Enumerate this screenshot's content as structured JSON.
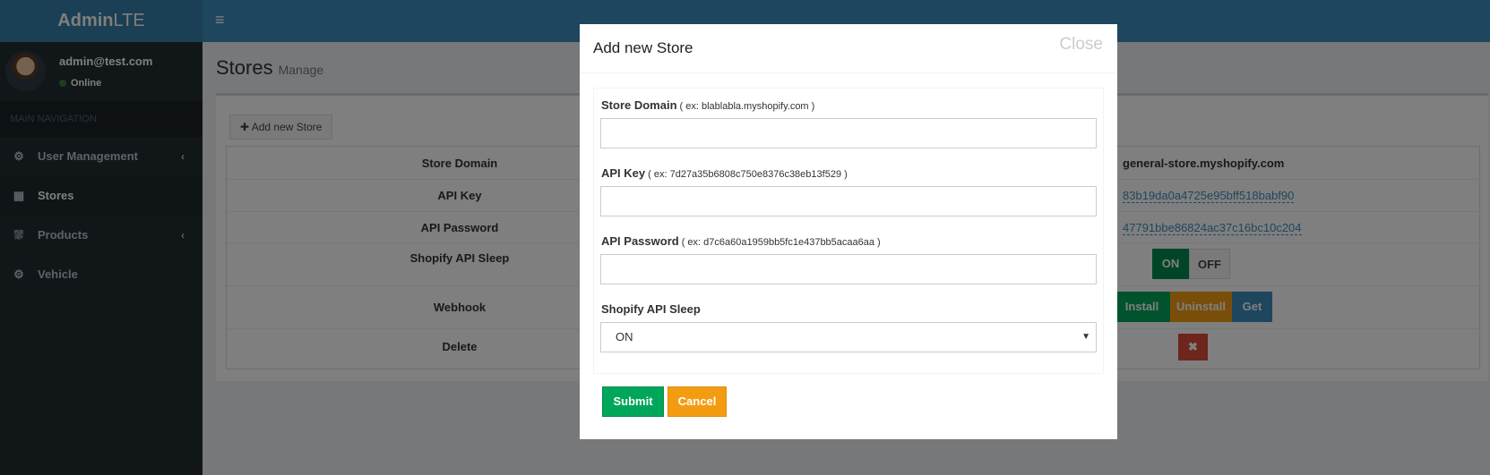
{
  "app": {
    "logo_bold": "Admin",
    "logo_rest": "LTE"
  },
  "user": {
    "name": "admin@test.com",
    "status": "Online"
  },
  "sidebar": {
    "header": "MAIN NAVIGATION",
    "items": [
      {
        "label": "User Management",
        "icon": "gear-icon",
        "has_children": true
      },
      {
        "label": "Stores",
        "icon": "building-icon",
        "active": true
      },
      {
        "label": "Products",
        "icon": "car-icon",
        "has_children": true
      },
      {
        "label": "Vehicle",
        "icon": "gears-icon"
      }
    ]
  },
  "page": {
    "title": "Stores",
    "subtitle": "Manage",
    "add_button": "Add new Store"
  },
  "table": {
    "rows": [
      {
        "label": "Store Domain",
        "value": "general-store.myshopify.com"
      },
      {
        "label": "API Key",
        "value": "83b19da0a4725e95bff518babf90"
      },
      {
        "label": "API Password",
        "value": "47791bbe86824ac37c16bc10c204"
      },
      {
        "label": "Shopify API Sleep",
        "on": "ON",
        "off": "OFF"
      },
      {
        "label": "Webhook",
        "install": "Install",
        "uninstall": "Uninstall",
        "get": "Get"
      },
      {
        "label": "Delete",
        "delete_icon": "times-icon"
      }
    ]
  },
  "modal": {
    "title": "Add new Store",
    "close": "Close",
    "fields": {
      "store_domain": {
        "label": "Store Domain",
        "hint": "( ex: blablabla.myshopify.com )",
        "value": ""
      },
      "api_key": {
        "label": "API Key",
        "hint": "( ex: 7d27a35b6808c750e8376c38eb13f529 )",
        "value": ""
      },
      "api_password": {
        "label": "API Password",
        "hint": "( ex: d7c6a60a1959bb5fc1e437bb5acaa6aa )",
        "value": ""
      },
      "sleep": {
        "label": "Shopify API Sleep",
        "selected": "ON"
      }
    },
    "submit": "Submit",
    "cancel": "Cancel"
  },
  "colors": {
    "brand": "#3c8dbc",
    "success": "#00a65a",
    "warning": "#f39c12",
    "danger": "#dd4b39",
    "sidebar": "#222d32"
  }
}
